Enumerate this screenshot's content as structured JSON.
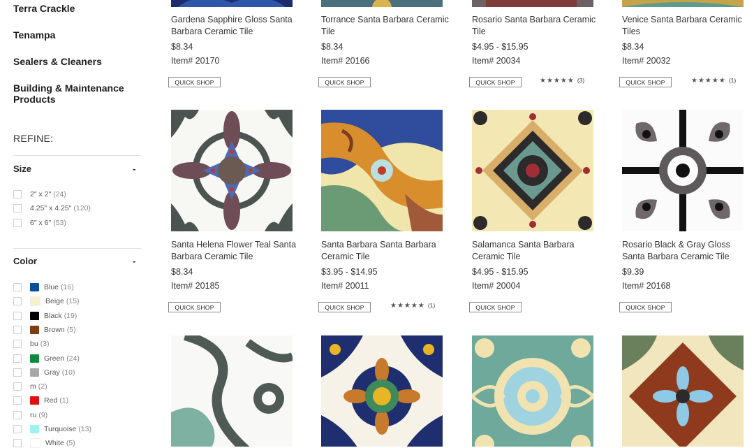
{
  "sidebar": {
    "categories": [
      "Terra Crackle",
      "Tenampa",
      "Sealers & Cleaners",
      "Building & Maintenance Products"
    ],
    "refine_label": "REFINE:",
    "size_facet": {
      "title": "Size",
      "toggle": "-",
      "options": [
        {
          "label": "2\" x 2\"",
          "count": "(24)"
        },
        {
          "label": "4.25\" x 4.25\"",
          "count": "(120)"
        },
        {
          "label": "6\" x 6\"",
          "count": "(53)"
        }
      ]
    },
    "color_facet": {
      "title": "Color",
      "toggle": "-",
      "options": [
        {
          "label": "Blue",
          "count": "(16)",
          "swatch": "#0a4f9a"
        },
        {
          "label": "Beige",
          "count": "(15)",
          "swatch": "#f6f0cf"
        },
        {
          "label": "Black",
          "count": "(19)",
          "swatch": "#000000"
        },
        {
          "label": "Brown",
          "count": "(5)",
          "swatch": "#7a3e12"
        },
        {
          "label": "bu",
          "count": "(3)",
          "swatch": ""
        },
        {
          "label": "Green",
          "count": "(24)",
          "swatch": "#0f8a3a"
        },
        {
          "label": "Gray",
          "count": "(10)",
          "swatch": "#a8a8a8"
        },
        {
          "label": "m",
          "count": "(2)",
          "swatch": ""
        },
        {
          "label": "Red",
          "count": "(1)",
          "swatch": "#e01010"
        },
        {
          "label": "ru",
          "count": "(9)",
          "swatch": ""
        },
        {
          "label": "Turquoise",
          "count": "(13)",
          "swatch": "#9ef2ef"
        },
        {
          "label": "White",
          "count": "(5)",
          "swatch": "#ffffff"
        }
      ]
    }
  },
  "quick_shop_label": "QUICK SHOP",
  "stars": "★★★★★",
  "products": [
    {
      "title": "Gardena Sapphire Gloss Santa Barbara Ceramic Tile",
      "price": "$8.34",
      "item": "Item# 20170",
      "rating": ""
    },
    {
      "title": "Torrance Santa Barbara Ceramic Tile",
      "price": "$8.34",
      "item": "Item# 20166",
      "rating": ""
    },
    {
      "title": "Rosario Santa Barbara Ceramic Tile",
      "price": "$4.95 - $15.95",
      "item": "Item# 20034",
      "rating": "(3)"
    },
    {
      "title": "Venice Santa Barbara Ceramic Tiles",
      "price": "$8.34",
      "item": "Item# 20032",
      "rating": "(1)"
    },
    {
      "title": "Santa Helena Flower Teal Santa Barbara Ceramic Tile",
      "price": "$8.34",
      "item": "Item# 20185",
      "rating": ""
    },
    {
      "title": "Santa Barbara Santa Barbara Ceramic Tile",
      "price": "$3.95 - $14.95",
      "item": "Item# 20011",
      "rating": "(1)"
    },
    {
      "title": "Salamanca Santa Barbara Ceramic Tile",
      "price": "$4.95 - $15.95",
      "item": "Item# 20004",
      "rating": ""
    },
    {
      "title": "Rosario Black & Gray Gloss Santa Barbara Ceramic Tile",
      "price": "$9.39",
      "item": "Item# 20168",
      "rating": ""
    }
  ]
}
